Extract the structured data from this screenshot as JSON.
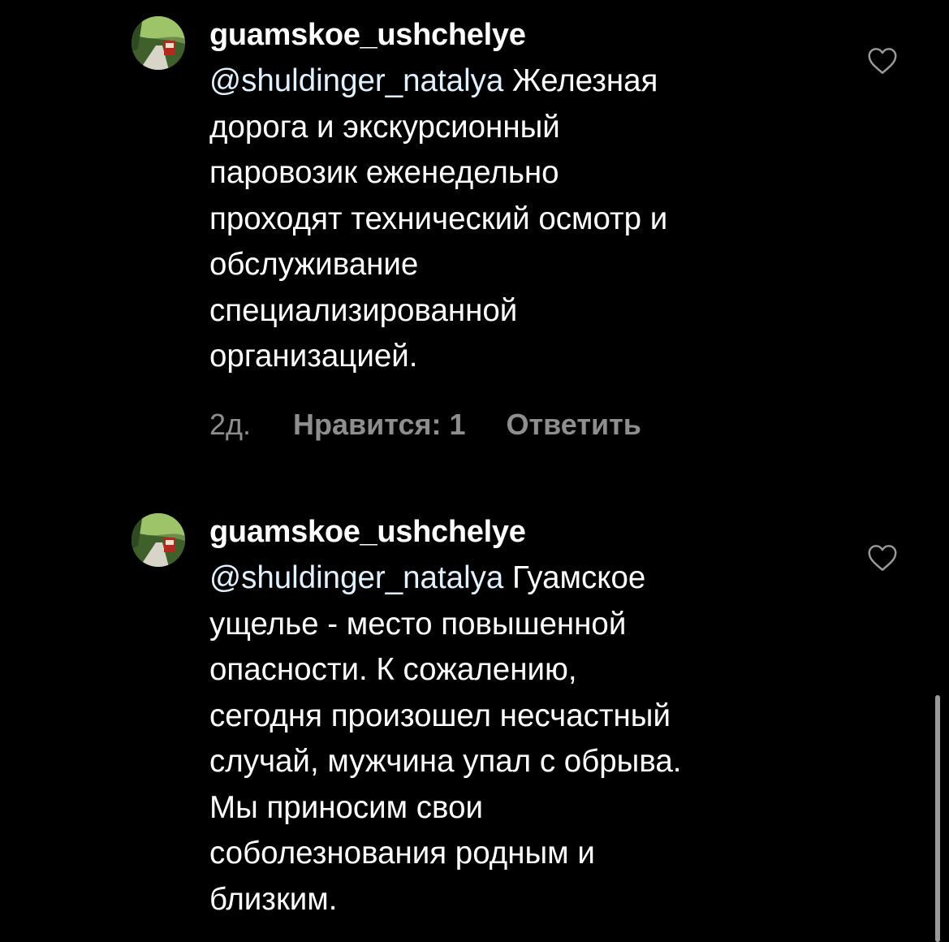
{
  "comments": [
    {
      "username": "guamskoe_ushchelye",
      "mention": "@shuldinger_natalya",
      "text": " Железная\nдорога и экскурсионный\nпаровозик  еженедельно\nпроходят технический осмотр и\nобслуживание\nспециализированной\nорганизацией.",
      "time": "2д.",
      "likes": "Нравится: 1",
      "reply": "Ответить",
      "like_icon": "heart-outline-icon"
    },
    {
      "username": "guamskoe_ushchelye",
      "mention": "@shuldinger_natalya",
      "text": " Гуамское\nущелье - место повышенной\nопасности. К сожалению,\nсегодня произошел несчастный\nслучай, мужчина упал с обрыва.\nМы приносим свои\nсоболезнования родным и\nблизким.",
      "like_icon": "heart-outline-icon"
    }
  ],
  "colors": {
    "background": "#000000",
    "text": "#ffffff",
    "secondary": "#8e8e8e"
  }
}
